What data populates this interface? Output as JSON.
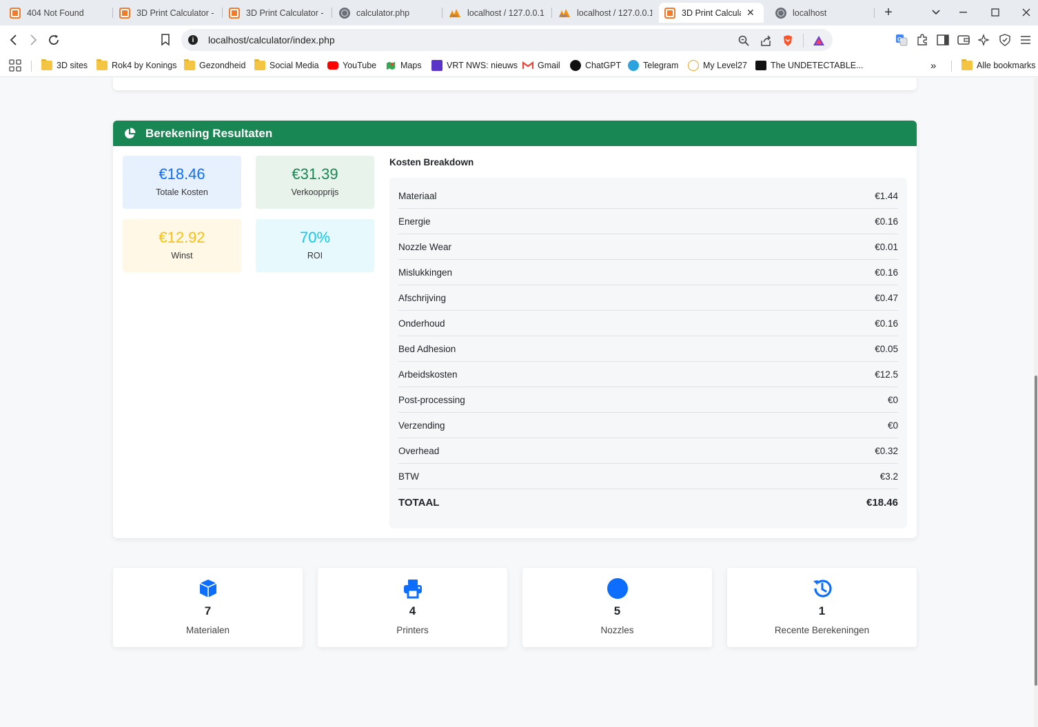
{
  "browser": {
    "tabs": [
      {
        "title": "404 Not Found",
        "icon": "xampp-icon"
      },
      {
        "title": "3D Print Calculator -",
        "icon": "xampp-icon"
      },
      {
        "title": "3D Print Calculator -",
        "icon": "xampp-icon"
      },
      {
        "title": "calculator.php",
        "icon": "globe-icon"
      },
      {
        "title": "localhost / 127.0.0.1",
        "icon": "phpmyadmin-icon"
      },
      {
        "title": "localhost / 127.0.0.1",
        "icon": "phpmyadmin-icon"
      },
      {
        "title": "3D Print Calcula",
        "icon": "xampp-icon",
        "active": true
      },
      {
        "title": "localhost",
        "icon": "globe-icon"
      }
    ],
    "url": "localhost/calculator/index.php",
    "bookmarks": [
      {
        "label": "3D sites",
        "icon": "folder-icon"
      },
      {
        "label": "Rok4 by Konings",
        "icon": "folder-icon"
      },
      {
        "label": "Gezondheid",
        "icon": "folder-icon"
      },
      {
        "label": "Social Media",
        "icon": "folder-icon"
      },
      {
        "label": "YouTube",
        "icon": "youtube-icon"
      },
      {
        "label": "Maps",
        "icon": "maps-icon"
      },
      {
        "label": "VRT NWS: nieuws",
        "icon": "vrt-icon"
      },
      {
        "label": "Gmail",
        "icon": "gmail-icon"
      },
      {
        "label": "ChatGPT",
        "icon": "chatgpt-icon"
      },
      {
        "label": "Telegram",
        "icon": "telegram-icon"
      },
      {
        "label": "My Level27",
        "icon": "level27-icon"
      },
      {
        "label": "The UNDETECTABLE...",
        "icon": "site-icon"
      },
      {
        "label": "Alle bookmarks",
        "icon": "folder-icon"
      }
    ],
    "more_bookmarks": "»"
  },
  "results": {
    "title": "Berekening Resultaten",
    "stats": [
      {
        "value": "€18.46",
        "label": "Totale Kosten",
        "color": "#0d6efd",
        "bg": "#e7f0fd"
      },
      {
        "value": "€31.39",
        "label": "Verkoopprijs",
        "color": "#198754",
        "bg": "#e8f3ec"
      },
      {
        "value": "€12.92",
        "label": "Winst",
        "color": "#ffc107",
        "bg": "#fff8e6"
      },
      {
        "value": "70%",
        "label": "ROI",
        "color": "#0dcaf0",
        "bg": "#e7f9fd"
      }
    ],
    "breakdown_title": "Kosten Breakdown",
    "breakdown": [
      {
        "label": "Materiaal",
        "value": "€1.44"
      },
      {
        "label": "Energie",
        "value": "€0.16"
      },
      {
        "label": "Nozzle Wear",
        "value": "€0.01"
      },
      {
        "label": "Mislukkingen",
        "value": "€0.16"
      },
      {
        "label": "Afschrijving",
        "value": "€0.47"
      },
      {
        "label": "Onderhoud",
        "value": "€0.16"
      },
      {
        "label": "Bed Adhesion",
        "value": "€0.05"
      },
      {
        "label": "Arbeidskosten",
        "value": "€12.5"
      },
      {
        "label": "Post-processing",
        "value": "€0"
      },
      {
        "label": "Verzending",
        "value": "€0"
      },
      {
        "label": "Overhead",
        "value": "€0.32"
      },
      {
        "label": "BTW",
        "value": "€3.2"
      }
    ],
    "total_label": "TOTAAL",
    "total_value": "€18.46"
  },
  "summary": [
    {
      "count": "7",
      "label": "Materialen",
      "icon": "cube-icon"
    },
    {
      "count": "4",
      "label": "Printers",
      "icon": "printer-icon"
    },
    {
      "count": "5",
      "label": "Nozzles",
      "icon": "circle-icon"
    },
    {
      "count": "1",
      "label": "Recente Berekeningen",
      "icon": "history-icon"
    }
  ],
  "colors": {
    "primary": "#0d6efd",
    "success": "#198754"
  }
}
